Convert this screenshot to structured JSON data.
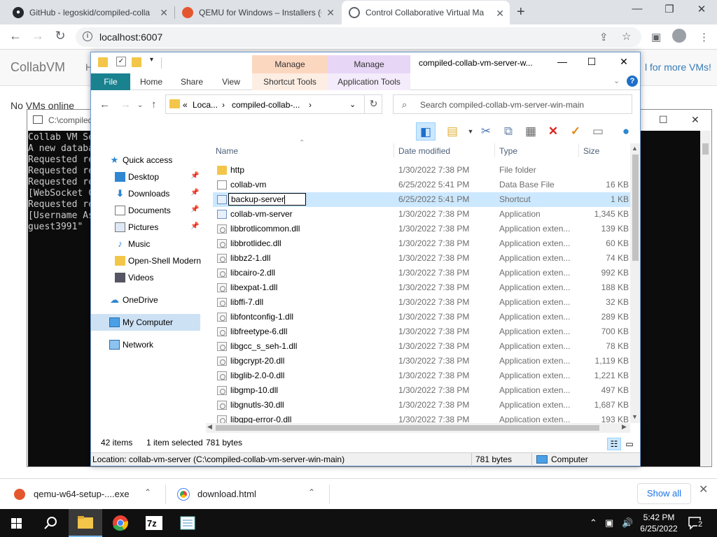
{
  "browser": {
    "tabs": [
      {
        "title": "GitHub - legoskid/compiled-colla",
        "icon": "github-icon",
        "active": false
      },
      {
        "title": "QEMU for Windows – Installers (6",
        "icon": "qemu-icon",
        "active": false
      },
      {
        "title": "Control Collaborative Virtual Ma",
        "icon": "globe-icon",
        "active": true
      }
    ],
    "new_tab": "+",
    "url": "localhost:6007",
    "close_glyph": "✕"
  },
  "collabvm": {
    "brand": "CollabVM",
    "header_partial": "H",
    "more_vms": "l for more VMs!",
    "no_vms": "No VMs online"
  },
  "console": {
    "title": "C:\\compiled",
    "lines": [
      "Collab VM Se",
      "A new databa",
      "Requested re",
      "Requested re",
      "Requested re",
      "[WebSocket C",
      "Requested re",
      "[Username As",
      "guest3991\""
    ]
  },
  "explorer": {
    "window_title": "compiled-collab-vm-server-w...",
    "context_tabs": [
      {
        "label": "Manage",
        "color": "#fcd7c0"
      },
      {
        "label": "Manage",
        "color": "#e7d6f6"
      }
    ],
    "ribbon_tabs": [
      "File",
      "Home",
      "Share",
      "View",
      "Shortcut Tools",
      "Application Tools"
    ],
    "address": {
      "crumbs": [
        "«",
        "Loca...",
        "›",
        "compiled-collab-...",
        "›"
      ]
    },
    "search_placeholder": "Search compiled-collab-vm-server-win-main",
    "nav": [
      {
        "label": "Quick access",
        "icon": "star-icon",
        "pinned": false
      },
      {
        "label": "Desktop",
        "icon": "desktop-icon",
        "pinned": true
      },
      {
        "label": "Downloads",
        "icon": "download-icon",
        "pinned": true
      },
      {
        "label": "Documents",
        "icon": "documents-icon",
        "pinned": true
      },
      {
        "label": "Pictures",
        "icon": "pictures-icon",
        "pinned": true
      },
      {
        "label": "Music",
        "icon": "music-icon",
        "pinned": false
      },
      {
        "label": "Open-Shell Modern",
        "icon": "folder-icon",
        "pinned": false
      },
      {
        "label": "Videos",
        "icon": "videos-icon",
        "pinned": false
      },
      {
        "label": "OneDrive",
        "icon": "onedrive-icon",
        "pinned": false
      },
      {
        "label": "My Computer",
        "icon": "computer-icon",
        "pinned": false
      },
      {
        "label": "Network",
        "icon": "network-icon",
        "pinned": false
      }
    ],
    "pin_glyph": "📌",
    "columns": {
      "name": "Name",
      "date": "Date modified",
      "type": "Type",
      "size": "Size"
    },
    "rename_text": "backup-server",
    "files": [
      {
        "name": "http",
        "date": "1/30/2022 7:38 PM",
        "type": "File folder",
        "size": "",
        "icon": "folder"
      },
      {
        "name": "collab-vm",
        "date": "6/25/2022 5:41 PM",
        "type": "Data Base File",
        "size": "16 KB",
        "icon": "file"
      },
      {
        "name": "backup-server",
        "date": "6/25/2022 5:41 PM",
        "type": "Shortcut",
        "size": "1 KB",
        "icon": "sc"
      },
      {
        "name": "collab-vm-server",
        "date": "1/30/2022 7:38 PM",
        "type": "Application",
        "size": "1,345 KB",
        "icon": "app"
      },
      {
        "name": "libbrotlicommon.dll",
        "date": "1/30/2022 7:38 PM",
        "type": "Application exten...",
        "size": "139 KB",
        "icon": "ext"
      },
      {
        "name": "libbrotlidec.dll",
        "date": "1/30/2022 7:38 PM",
        "type": "Application exten...",
        "size": "60 KB",
        "icon": "ext"
      },
      {
        "name": "libbz2-1.dll",
        "date": "1/30/2022 7:38 PM",
        "type": "Application exten...",
        "size": "74 KB",
        "icon": "ext"
      },
      {
        "name": "libcairo-2.dll",
        "date": "1/30/2022 7:38 PM",
        "type": "Application exten...",
        "size": "992 KB",
        "icon": "ext"
      },
      {
        "name": "libexpat-1.dll",
        "date": "1/30/2022 7:38 PM",
        "type": "Application exten...",
        "size": "188 KB",
        "icon": "ext"
      },
      {
        "name": "libffi-7.dll",
        "date": "1/30/2022 7:38 PM",
        "type": "Application exten...",
        "size": "32 KB",
        "icon": "ext"
      },
      {
        "name": "libfontconfig-1.dll",
        "date": "1/30/2022 7:38 PM",
        "type": "Application exten...",
        "size": "289 KB",
        "icon": "ext"
      },
      {
        "name": "libfreetype-6.dll",
        "date": "1/30/2022 7:38 PM",
        "type": "Application exten...",
        "size": "700 KB",
        "icon": "ext"
      },
      {
        "name": "libgcc_s_seh-1.dll",
        "date": "1/30/2022 7:38 PM",
        "type": "Application exten...",
        "size": "78 KB",
        "icon": "ext"
      },
      {
        "name": "libgcrypt-20.dll",
        "date": "1/30/2022 7:38 PM",
        "type": "Application exten...",
        "size": "1,119 KB",
        "icon": "ext"
      },
      {
        "name": "libglib-2.0-0.dll",
        "date": "1/30/2022 7:38 PM",
        "type": "Application exten...",
        "size": "1,221 KB",
        "icon": "ext"
      },
      {
        "name": "libgmp-10.dll",
        "date": "1/30/2022 7:38 PM",
        "type": "Application exten...",
        "size": "497 KB",
        "icon": "ext"
      },
      {
        "name": "libgnutls-30.dll",
        "date": "1/30/2022 7:38 PM",
        "type": "Application exten...",
        "size": "1,687 KB",
        "icon": "ext"
      },
      {
        "name": "libgpg-error-0.dll",
        "date": "1/30/2022 7:38 PM",
        "type": "Application exten...",
        "size": "193 KB",
        "icon": "ext"
      }
    ],
    "selected_index": 2,
    "status": {
      "items": "42 items",
      "selected": "1 item selected",
      "size": "781 bytes"
    },
    "location_bar": {
      "location": "Location: collab-vm-server (C:\\compiled-collab-vm-server-win-main)",
      "size": "781 bytes",
      "computer": "Computer"
    }
  },
  "downloads": [
    {
      "name": "qemu-w64-setup-....exe",
      "icon": "qemu-icon"
    },
    {
      "name": "download.html",
      "icon": "chrome-icon"
    }
  ],
  "show_all": "Show all",
  "taskbar": {
    "time": "5:42 PM",
    "date": "6/25/2022",
    "notification_count": "2"
  },
  "colors": {
    "accent_file_tab": "#19828e",
    "selection": "#cce8ff",
    "taskbar": "#101010"
  }
}
